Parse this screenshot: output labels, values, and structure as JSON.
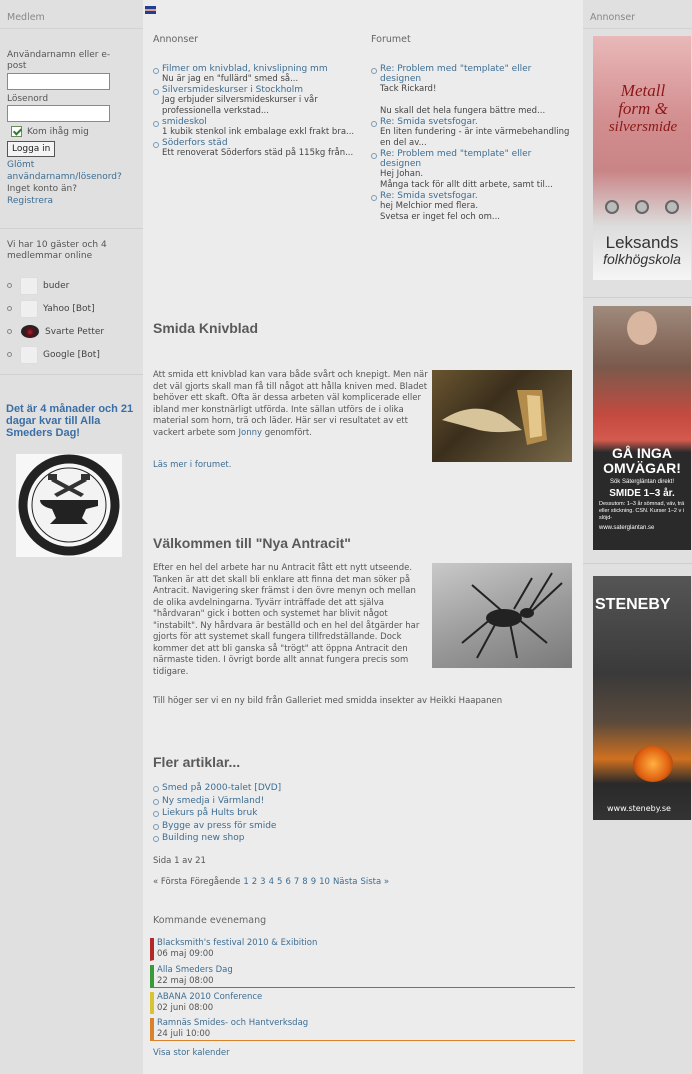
{
  "left": {
    "header": "Medlem",
    "username_label": "Användarnamn eller e-post",
    "password_label": "Lösenord",
    "remember_label": "Kom ihåg mig",
    "login_button": "Logga in",
    "forgot_link": "Glömt användarnamn/lösenord?",
    "no_account": "Inget konto än?",
    "register_link": "Registrera",
    "online_text": "Vi har 10 gäster och 4 medlemmar online",
    "online_users": [
      "buder",
      "Yahoo [Bot]",
      "Svarte Petter",
      "Google [Bot]"
    ],
    "countdown": "Det är 4 månader och 21 dagar kvar till Alla Smeders Dag!",
    "logo_text_top": "INTERNATIONAL BLACKSMITHS DAY",
    "logo_text_bottom": "22 MAY"
  },
  "main": {
    "annonser_title": "Annonser",
    "annonser": [
      {
        "title": "Filmer om knivblad, knivslipning mm",
        "desc": "Nu är jag en \"fullärd\" smed så..."
      },
      {
        "title": "Silversmideskurser i Stockholm",
        "desc": "Jag erbjuder silversmideskurser i vår professionella verkstad..."
      },
      {
        "title": "smideskol",
        "desc": "1 kubik stenkol ink embalage exkl frakt bra..."
      },
      {
        "title": "Söderfors städ",
        "desc": "Ett renoverat Söderfors städ på 115kg från..."
      }
    ],
    "forum_title": "Forumet",
    "forum": [
      {
        "title": "Re: Problem med \"template\" eller designen",
        "desc": "Tack Rickard!\n\nNu skall det hela fungera bättre med..."
      },
      {
        "title": "Re: Smida svetsfogar.",
        "desc": "En liten fundering - är inte värmebehandling en del av..."
      },
      {
        "title": "Re: Problem med \"template\" eller designen",
        "desc": "Hej Johan.\nMånga tack för allt ditt arbete, samt til..."
      },
      {
        "title": "Re: Smida svetsfogar.",
        "desc": "hej Melchior med flera.\nSvetsa er inget fel och om..."
      }
    ],
    "article1": {
      "title": "Smida Knivblad",
      "body": "Att smida ett knivblad kan vara både svårt och knepigt. Men när det väl gjorts skall man få till något att hålla kniven med. Bladet behöver ett skaft. Ofta är dessa arbeten väl komplicerade eller ibland mer konstnärligt utförda. Inte sällan utförs de i olika material som horn, trä och läder. Här ser vi resultatet av ett vackert arbete som",
      "author_link": "Jonny",
      "body_end": "genomfört.",
      "read_more": "Läs mer i forumet."
    },
    "article2": {
      "title": "Välkommen till \"Nya Antracit\"",
      "body": "Efter en hel del arbete har nu Antracit fått ett nytt utseende. Tanken är att det skall bli enklare att finna det man söker på Antracit. Navigering sker främst i den övre menyn och mellan de olika avdelningarna. Tyvärr inträffade det att själva \"hårdvaran\" gick i botten och systemet har blivit något \"instabilt\". Ny hårdvara är beställd och en hel del åtgärder har gjorts för att systemet skall fungera tillfredställande. Dock kommer det att bli ganska så \"trögt\" att öppna Antracit den närmaste tiden. I övrigt borde allt annat fungera precis som tidigare.",
      "caption": "Till höger ser vi en ny bild från Galleriet med smidda insekter av Heikki Haapanen"
    },
    "more_title": "Fler artiklar...",
    "more": [
      "Smed på 2000-talet [DVD]",
      "Ny smedja i Värmland!",
      "Liekurs på Hults bruk",
      "Bygge av press för smide",
      "Building new shop"
    ],
    "page_info": "Sida 1 av 21",
    "pagination": [
      "« Första",
      "Föregående",
      "1",
      "2",
      "3",
      "4",
      "5",
      "6",
      "7",
      "8",
      "9",
      "10",
      "Nästa",
      "Sista »"
    ],
    "events_title": "Kommande evenemang",
    "events": [
      {
        "title": "Blacksmith's festival 2010 & Exibition",
        "date": "06 maj 09:00",
        "color": "#b02a2a"
      },
      {
        "title": "Alla Smeders Dag",
        "date": "22 maj 08:00",
        "color": "#3a9a3a"
      },
      {
        "title": "ABANA 2010 Conference",
        "date": "02 juni 08:00",
        "color": "#d8c432"
      },
      {
        "title": "Ramnäs Smides- och Hantverksdag",
        "date": "24 juli 10:00",
        "color": "#d9822b"
      }
    ],
    "calendar_link": "Visa stor kalender"
  },
  "right": {
    "header": "Annonser",
    "ad1": {
      "line1": "Metall",
      "line2": "form &",
      "line3": "silversmide",
      "brand1": "Leksands",
      "brand2": "folkhögskola"
    },
    "ad2": {
      "head1": "GÅ INGA",
      "head2": "OMVÄGAR!",
      "sub": "Sök Sätergläntan direkt!",
      "big": "SMIDE 1–3 år.",
      "small": "Dessutom: 1–3 år sömnad, väv, trä eller stickning. CSN. Kurser 1–2 v i slöjd-",
      "url": "www.saterglantan.se"
    },
    "ad3": {
      "title": "STENEBY",
      "url": "www.steneby.se"
    }
  }
}
